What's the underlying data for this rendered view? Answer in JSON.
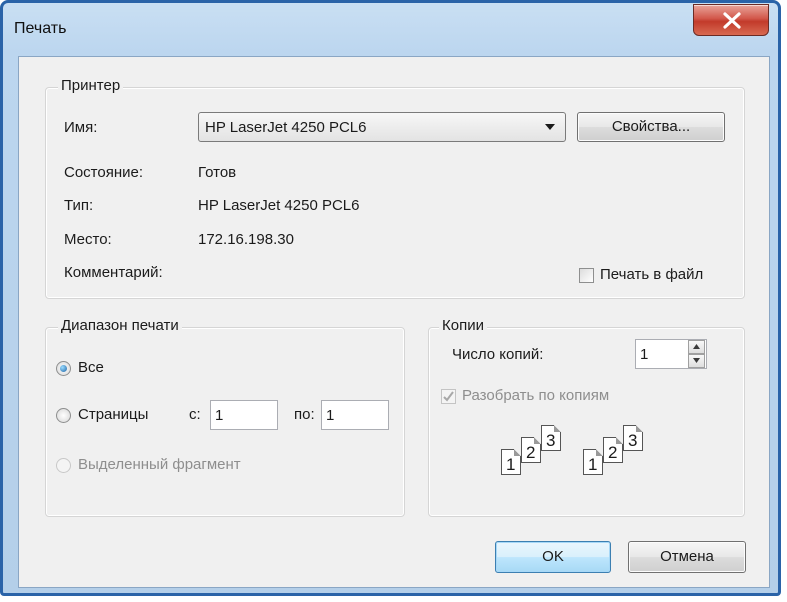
{
  "window": {
    "title": "Печать",
    "close_glyph": "x"
  },
  "printer": {
    "legend": "Принтер",
    "name_label": "Имя:",
    "name_value": "HP LaserJet 4250 PCL6",
    "properties_label": "Свойства...",
    "status_label": "Состояние:",
    "status_value": "Готов",
    "type_label": "Тип:",
    "type_value": "HP LaserJet 4250 PCL6",
    "location_label": "Место:",
    "location_value": "172.16.198.30",
    "comment_label": "Комментарий:",
    "print_to_file_label": "Печать в файл"
  },
  "range": {
    "legend": "Диапазон печати",
    "all_label": "Все",
    "pages_label": "Страницы",
    "from_label": "с:",
    "from_value": "1",
    "to_label": "по:",
    "to_value": "1",
    "selection_label": "Выделенный фрагмент"
  },
  "copies": {
    "legend": "Копии",
    "count_label": "Число копий:",
    "count_value": "1",
    "collate_label": "Разобрать по копиям",
    "collate_pages": [
      "1",
      "2",
      "3"
    ]
  },
  "footer": {
    "ok_label": "OK",
    "cancel_label": "Отмена"
  },
  "colors": {
    "frame_border": "#2a63a8",
    "client_bg": "#f0f0f0",
    "close_red": "#c23a2a",
    "radio_fill": "#1c63a5"
  },
  "icons": [
    "close-icon",
    "dropdown-arrow-icon",
    "spin-up-icon",
    "spin-down-icon",
    "checkmark-icon",
    "collate-pages-icon"
  ]
}
